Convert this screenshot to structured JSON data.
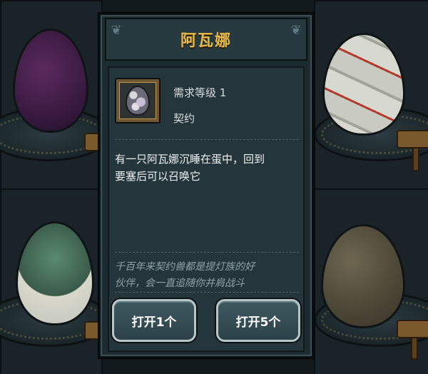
{
  "dialog": {
    "title": "阿瓦娜",
    "item": {
      "icon": "egg-icon",
      "level_requirement": "需求等级 1",
      "type": "契约"
    },
    "description_lines": [
      "有一只阿瓦娜沉睡在蛋中，回到",
      "要塞后可以召唤它"
    ],
    "flavor_lines": [
      "千百年来契约兽都是提灯族的好",
      "伙伴，会一直追随你并肩战斗"
    ],
    "buttons": {
      "open_one": "打开1个",
      "open_five": "打开5个"
    }
  },
  "colors": {
    "title": "#e7b84a",
    "panel": "#1c2b30",
    "button": "#3f5860",
    "button_border": "#b9c6c8"
  }
}
